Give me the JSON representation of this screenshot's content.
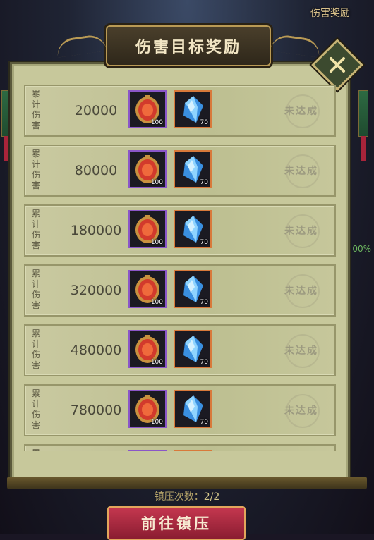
{
  "background": {
    "corner_label": "伤害奖励",
    "side_text": "00%"
  },
  "dialog": {
    "title": "伤害目标奖励",
    "row_label": "累计伤害",
    "rows": [
      {
        "value": "20000",
        "medal_qty": "100",
        "crystal_qty": "70",
        "status": "未达成"
      },
      {
        "value": "80000",
        "medal_qty": "100",
        "crystal_qty": "70",
        "status": "未达成"
      },
      {
        "value": "180000",
        "medal_qty": "100",
        "crystal_qty": "70",
        "status": "未达成"
      },
      {
        "value": "320000",
        "medal_qty": "100",
        "crystal_qty": "70",
        "status": "未达成"
      },
      {
        "value": "480000",
        "medal_qty": "100",
        "crystal_qty": "70",
        "status": "未达成"
      },
      {
        "value": "780000",
        "medal_qty": "100",
        "crystal_qty": "70",
        "status": "未达成"
      },
      {
        "value": "",
        "medal_qty": "",
        "crystal_qty": "",
        "status": ""
      }
    ],
    "icons": {
      "medal": "red-medal-icon",
      "crystal": "blue-crystal-icon",
      "close": "close-icon"
    }
  },
  "footer": {
    "attempts_label": "镇压次数：",
    "attempts_value": "2/2",
    "go_button": "前往镇压"
  },
  "colors": {
    "medal_border": "#8a56c8",
    "crystal_border": "#d8793a",
    "button": "#c4374f"
  }
}
